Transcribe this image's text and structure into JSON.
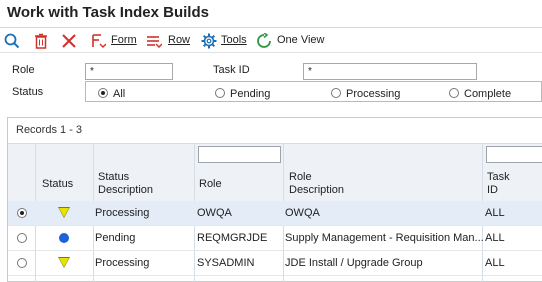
{
  "window": {
    "title": "Work with Task Index Builds"
  },
  "toolbar": {
    "form_label": "Form",
    "row_label": "Row",
    "tools_label": "Tools",
    "oneview_label": "One View"
  },
  "filters": {
    "role_label": "Role",
    "role_value": "*",
    "taskid_label": "Task ID",
    "taskid_value": "*",
    "status_label": "Status",
    "status_options": [
      "All",
      "Pending",
      "Processing",
      "Complete"
    ],
    "status_selected": "All"
  },
  "grid": {
    "records_label": "Records 1 - 3",
    "columns": {
      "status": "Status",
      "status_desc_1": "Status",
      "status_desc_2": "Description",
      "role": "Role",
      "role_desc_1": "Role",
      "role_desc_2": "Description",
      "task_1": "Task",
      "task_2": "ID"
    },
    "rows": [
      {
        "status_icon": "yellow-triangle-icon",
        "status_desc": "Processing",
        "role": "OWQA",
        "role_desc": "OWQA",
        "task_id": "ALL",
        "selected": true
      },
      {
        "status_icon": "blue-circle-icon",
        "status_desc": "Pending",
        "role": "REQMGRJDE",
        "role_desc": "Supply Management - Requisition Man...",
        "task_id": "ALL",
        "selected": false
      },
      {
        "status_icon": "yellow-triangle-icon",
        "status_desc": "Processing",
        "role": "SYSADMIN",
        "role_desc": "JDE Install / Upgrade Group",
        "task_id": "ALL",
        "selected": false
      }
    ]
  },
  "colors": {
    "accent": "#1f62d6",
    "warning": "#e8e200",
    "danger": "#d0312d",
    "selected_row": "#e3ecf7"
  }
}
